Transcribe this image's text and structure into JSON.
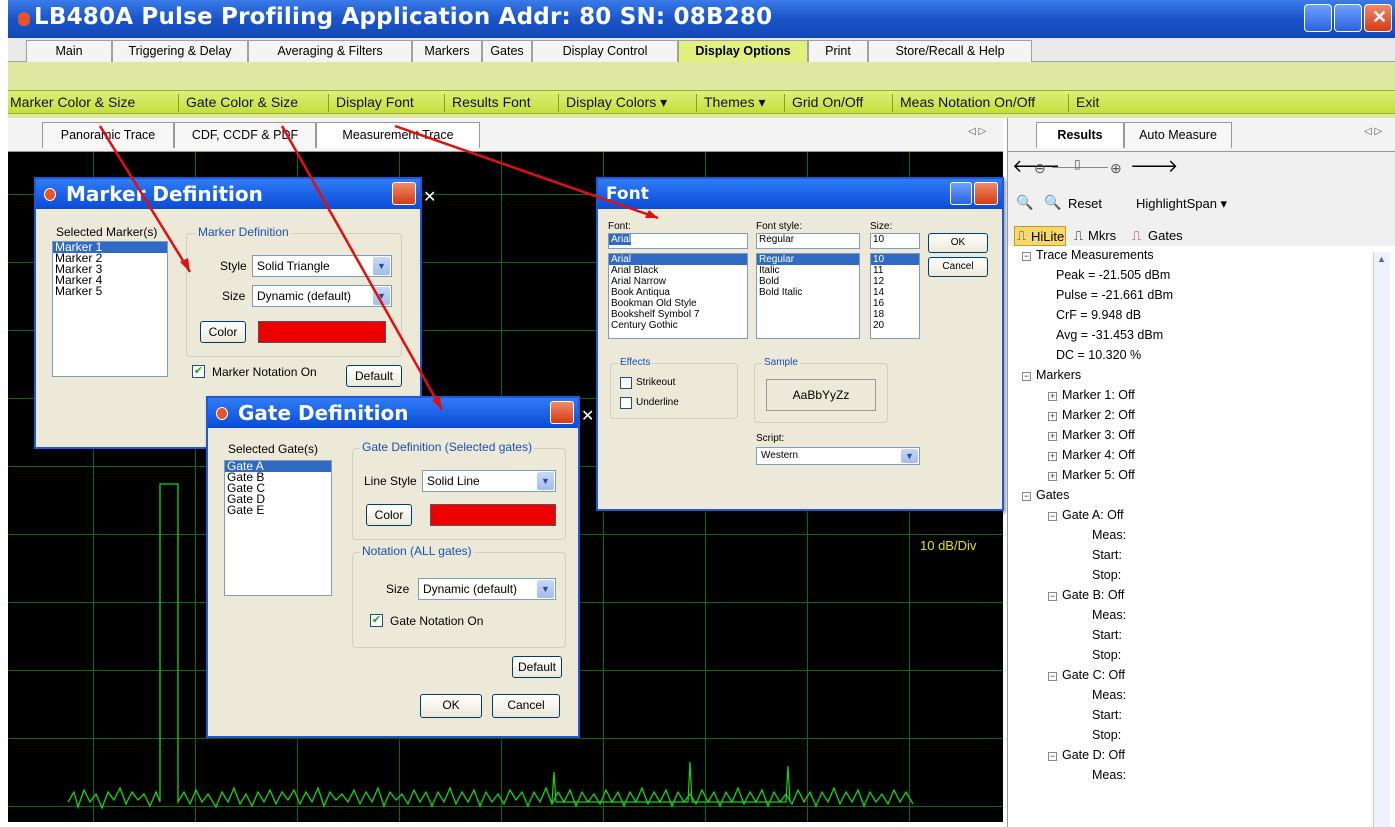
{
  "window": {
    "title": "LB480A Pulse Profiling Application  Addr: 80  SN: 08B280"
  },
  "tabs": [
    "Main",
    "Triggering & Delay",
    "Averaging & Filters",
    "Markers",
    "Gates",
    "Display Control",
    "Display Options",
    "Print",
    "Store/Recall & Help"
  ],
  "active_tab": "Display Options",
  "toolbar": [
    "Marker Color & Size",
    "Gate Color & Size",
    "Display Font",
    "Results Font",
    "Display Colors ▾",
    "Themes ▾",
    "Grid On/Off",
    "Meas Notation On/Off",
    "Exit"
  ],
  "subtabs": [
    "Panoramic Trace",
    "CDF, CCDF & PDF",
    "Measurement Trace"
  ],
  "chart": {
    "scale_label": "10 dB/Div",
    "trace_color": "#15d615",
    "grid_color": "#0d6a0d",
    "background": "#000000"
  },
  "marker_dialog": {
    "title": "Marker Definition",
    "selected_label": "Selected Marker(s)",
    "markers": [
      "Marker 1",
      "Marker 2",
      "Marker 3",
      "Marker 4",
      "Marker 5"
    ],
    "group_label": "Marker Definition",
    "style_label": "Style",
    "style_value": "Solid Triangle",
    "size_label": "Size",
    "size_value": "Dynamic (default)",
    "color_button": "Color",
    "color": "#ee0000",
    "notation_label": "Marker Notation On",
    "default_button": "Default"
  },
  "gate_dialog": {
    "title": "Gate Definition",
    "selected_label": "Selected Gate(s)",
    "gates": [
      "Gate A",
      "Gate B",
      "Gate C",
      "Gate D",
      "Gate E"
    ],
    "group_label": "Gate Definition (Selected gates)",
    "linestyle_label": "Line Style",
    "linestyle_value": "Solid Line",
    "color_button": "Color",
    "color": "#ee0000",
    "notation_group": "Notation (ALL gates)",
    "size_label": "Size",
    "size_value": "Dynamic (default)",
    "notation_label": "Gate Notation On",
    "default_button": "Default",
    "ok_button": "OK",
    "cancel_button": "Cancel"
  },
  "font_dialog": {
    "title": "Font",
    "font_label": "Font:",
    "font_value": "Arial",
    "fonts": [
      "Arial",
      "Arial Black",
      "Arial Narrow",
      "Book Antiqua",
      "Bookman Old Style",
      "Bookshelf Symbol 7",
      "Century Gothic"
    ],
    "style_label": "Font style:",
    "style_value": "Regular",
    "styles": [
      "Regular",
      "Italic",
      "Bold",
      "Bold Italic"
    ],
    "size_label": "Size:",
    "size_value": "10",
    "sizes": [
      "10",
      "11",
      "12",
      "14",
      "16",
      "18",
      "20"
    ],
    "ok_button": "OK",
    "cancel_button": "Cancel",
    "effects_label": "Effects",
    "strikeout_label": "Strikeout",
    "underline_label": "Underline",
    "sample_label": "Sample",
    "sample_text": "AaBbYyZz",
    "script_label": "Script:",
    "script_value": "Western"
  },
  "results_panel": {
    "tabs": [
      "Results",
      "Auto Measure"
    ],
    "zoom_tools": {
      "reset": "Reset",
      "highlight_span": "HighlightSpan ▾"
    },
    "view_buttons": [
      "HiLite",
      "Mkrs",
      "Gates"
    ],
    "trace_header": "Trace Measurements",
    "measurements": [
      "Peak =  -21.505 dBm",
      "Pulse =  -21.661 dBm",
      "CrF =   9.948 dB",
      "Avg =  -31.453 dBm",
      "DC =  10.320 %"
    ],
    "markers_header": "Markers",
    "markers": [
      "Marker 1: Off",
      "Marker 2: Off",
      "Marker 3: Off",
      "Marker 4: Off",
      "Marker 5: Off"
    ],
    "gates_header": "Gates",
    "gates": [
      {
        "name": "Gate A: Off",
        "fields": [
          "Meas:",
          "Start:",
          "Stop:"
        ]
      },
      {
        "name": "Gate B: Off",
        "fields": [
          "Meas:",
          "Start:",
          "Stop:"
        ]
      },
      {
        "name": "Gate C: Off",
        "fields": [
          "Meas:",
          "Start:",
          "Stop:"
        ]
      },
      {
        "name": "Gate D: Off",
        "fields": [
          "Meas:"
        ]
      }
    ]
  }
}
